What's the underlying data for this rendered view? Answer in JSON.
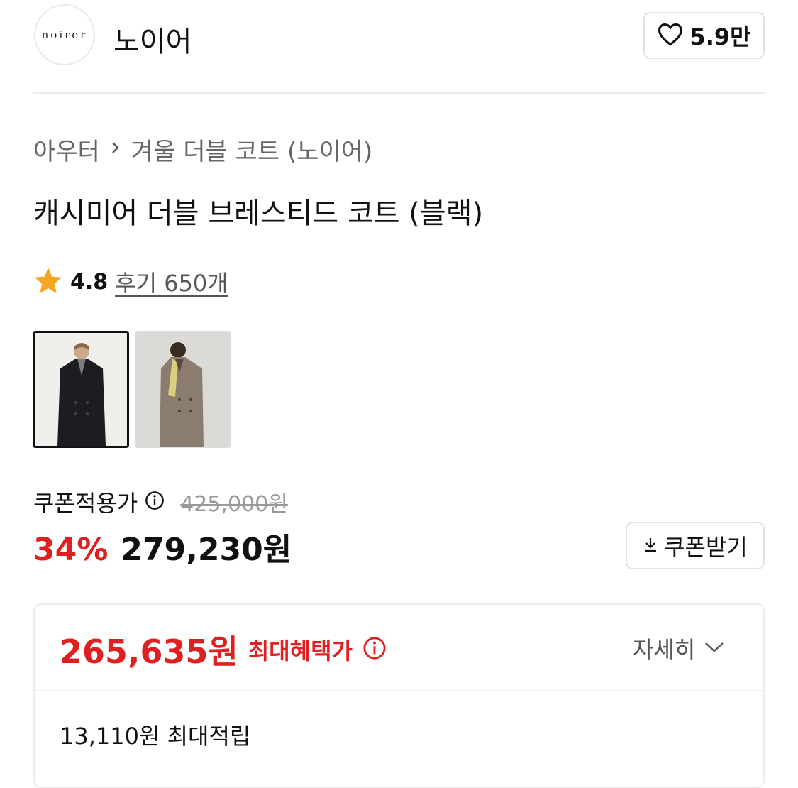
{
  "header": {
    "logo_text": "noirer",
    "brand_name": "노이어",
    "like_count": "5.9만"
  },
  "breadcrumb": [
    "아우터",
    "겨울 더블 코트 (노이어)"
  ],
  "product": {
    "title": "캐시미어 더블 브레스티드 코트 (블랙)",
    "rating": "4.8",
    "review_text": "후기 650개"
  },
  "thumbnails": [
    {
      "coat_color": "#1b1d20",
      "background": "#f0efeb",
      "selected": true
    },
    {
      "coat_color": "#8a7d70",
      "background": "#dcdad6",
      "selected": false
    }
  ],
  "price": {
    "coupon_label": "쿠폰적용가",
    "original": "425,000원",
    "discount": "34%",
    "sale": "279,230원",
    "coupon_button": "쿠폰받기"
  },
  "benefit": {
    "max_price": "265,635원",
    "max_label": "최대혜택가",
    "detail_label": "자세히",
    "points": "13,110원 최대적립"
  },
  "colors": {
    "accent_red": "#e02020",
    "star": "#f5a623",
    "muted": "#555555"
  },
  "icons": [
    "heart-icon",
    "chevron-right-icon",
    "star-icon",
    "info-icon",
    "download-icon",
    "chevron-down-icon"
  ]
}
